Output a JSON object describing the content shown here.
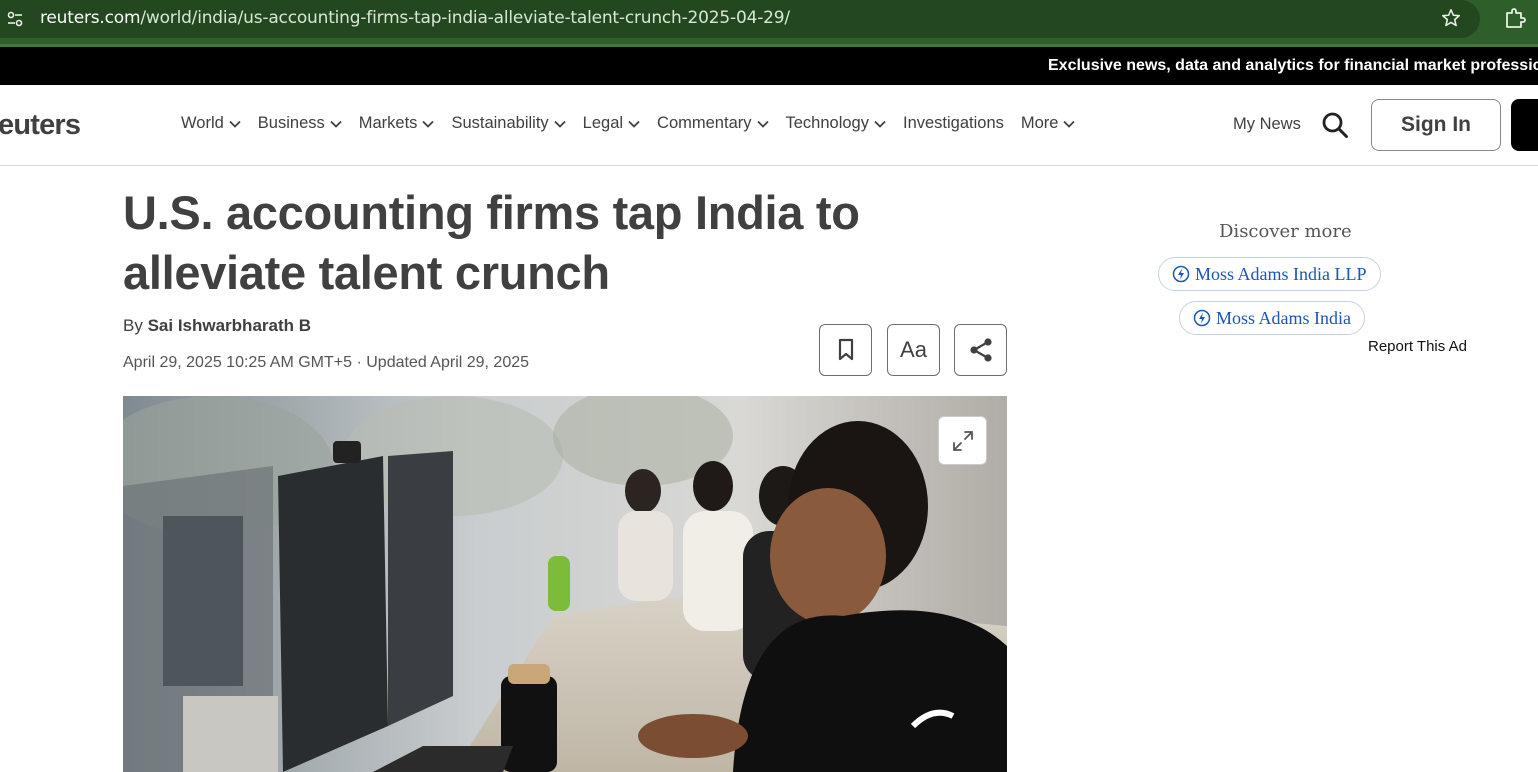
{
  "browser": {
    "url_host": "reuters.com",
    "url_path": "/world/india/us-accounting-firms-tap-india-alleviate-talent-crunch-2025-04-29/"
  },
  "ticker": {
    "text": "Exclusive news, data and analytics for financial market professio"
  },
  "nav": {
    "logo": "euters",
    "items": [
      {
        "label": "World",
        "has_menu": true
      },
      {
        "label": "Business",
        "has_menu": true
      },
      {
        "label": "Markets",
        "has_menu": true
      },
      {
        "label": "Sustainability",
        "has_menu": true
      },
      {
        "label": "Legal",
        "has_menu": true
      },
      {
        "label": "Commentary",
        "has_menu": true
      },
      {
        "label": "Technology",
        "has_menu": true
      },
      {
        "label": "Investigations",
        "has_menu": false
      },
      {
        "label": "More",
        "has_menu": true
      }
    ],
    "my_news": "My News",
    "sign_in": "Sign In"
  },
  "article": {
    "headline": "U.S. accounting firms tap India to alleviate talent crunch",
    "byline_prefix": "By",
    "author": "Sai Ishwarbharath B",
    "dateline": "April 29, 2025 10:25 AM GMT+5 · Updated April 29, 2025",
    "font_button": "Aa"
  },
  "sidebar": {
    "discover_title": "Discover more",
    "chips": [
      "Moss Adams India LLP",
      "Moss Adams India"
    ],
    "report_ad": "Report This Ad"
  },
  "colors": {
    "browser_bar": "#2e5e2a",
    "ticker_bg": "#000000",
    "text": "#404040",
    "chip_link": "#1a56b8"
  }
}
